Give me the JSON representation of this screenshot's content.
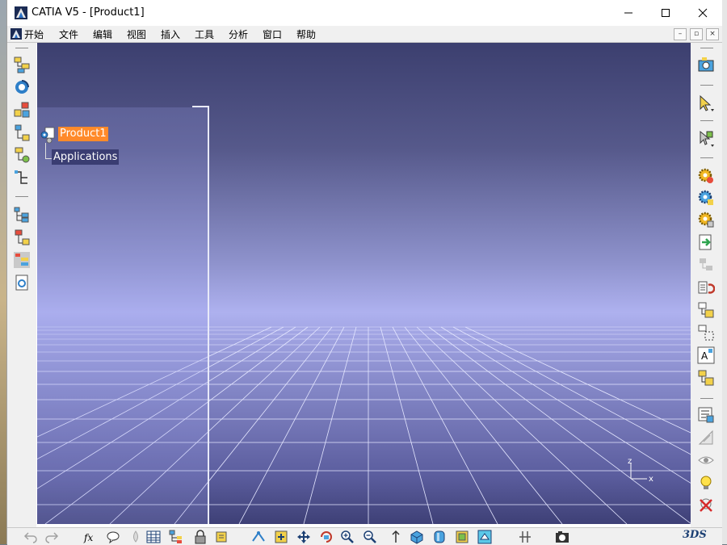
{
  "window": {
    "title": "CATIA V5 - [Product1]"
  },
  "menu": {
    "items": [
      "开始",
      "文件",
      "编辑",
      "视图",
      "插入",
      "工具",
      "分析",
      "窗口",
      "帮助"
    ]
  },
  "tree": {
    "root": "Product1",
    "child": "Applications"
  },
  "compass": {
    "z": "z",
    "x": "x"
  },
  "brand": {
    "logo": "3DS"
  },
  "colors": {
    "selected_node": "#ff8a2a",
    "node_bg": "#3a3d72",
    "viewport_top": "#3c3f6f",
    "viewport_mid": "#aeb1ef"
  },
  "icons": {
    "left_toolbar": [
      "product-tree-icon",
      "swirl-icon",
      "assembly-icon",
      "structure-icon",
      "component-icon",
      "hierarchy-icon",
      "tree-expand-icon",
      "tree-branch-icon",
      "tree-table-icon",
      "document-icon"
    ],
    "right_toolbar": [
      "camera-icon",
      "select-arrow-icon",
      "select-3d-icon",
      "gear-yellow-icon",
      "gear-blue-icon",
      "gear-grid-icon",
      "green-arrow-icon",
      "fade-icon",
      "product-red-icon",
      "product-yellow-icon",
      "grid-insert-icon",
      "text-icon",
      "table-icon",
      "constraint-icon",
      "measure-icon",
      "eye-icon",
      "bulb-icon",
      "x-red-icon"
    ],
    "bottom_toolbar": [
      "undo-icon",
      "redo-icon",
      "fx-icon",
      "chat-icon",
      "drop-icon",
      "table-grid-icon",
      "tree-view-icon",
      "lock-icon",
      "tag-icon",
      "fly-icon",
      "fit-all-icon",
      "pan-icon",
      "rotate-icon",
      "zoom-in-icon",
      "zoom-out-icon",
      "normal-view-icon",
      "iso-view-icon",
      "shading-icon",
      "box-icon",
      "hide-icon",
      "swap-icon",
      "grid-snap-icon",
      "capture-icon"
    ]
  }
}
